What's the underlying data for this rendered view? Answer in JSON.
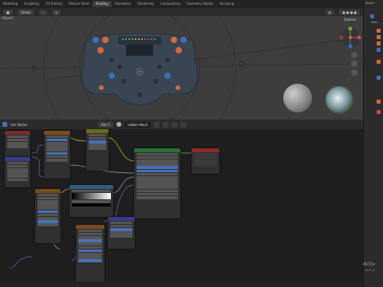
{
  "workspace_tabs": [
    "Modeling",
    "Sculpting",
    "UV Editing",
    "Texture Paint",
    "Shading",
    "Animation",
    "Rendering",
    "Compositing",
    "Geometry Nodes",
    "Scripting"
  ],
  "active_tab": "Shading",
  "viewport": {
    "object_label": "Object",
    "orientation": "Global",
    "options_label": "Options"
  },
  "node_editor": {
    "use_nodes_label": "Use Nodes",
    "slot_label": "Slot 1",
    "material_name": "rubber black"
  },
  "right_panel": {
    "scene_label": "Scene",
    "first_item": "Scen"
  },
  "activate_windows": {
    "title": "Activ",
    "subtitle": "Go to S"
  },
  "colors": {
    "accent_blue": "#4772b3",
    "header_bg": "#2b2b2b",
    "viewport_bg": "#3d3d3d",
    "node_editor_bg": "#1e1e1e",
    "principled_header": "#2a6f3a",
    "output_header": "#8a2a2a",
    "texture_header": "#7a4a1f",
    "mapping_header": "#3a3a8a",
    "shader_header": "#2a5f7a",
    "color_ramp_header": "#6a6a1a"
  },
  "icons": {
    "gizmo": "navigation-gizmo-icon",
    "material": "material-sphere-icon",
    "hand": "hand-pan-icon",
    "camera": "camera-icon",
    "zoom": "zoom-icon"
  }
}
